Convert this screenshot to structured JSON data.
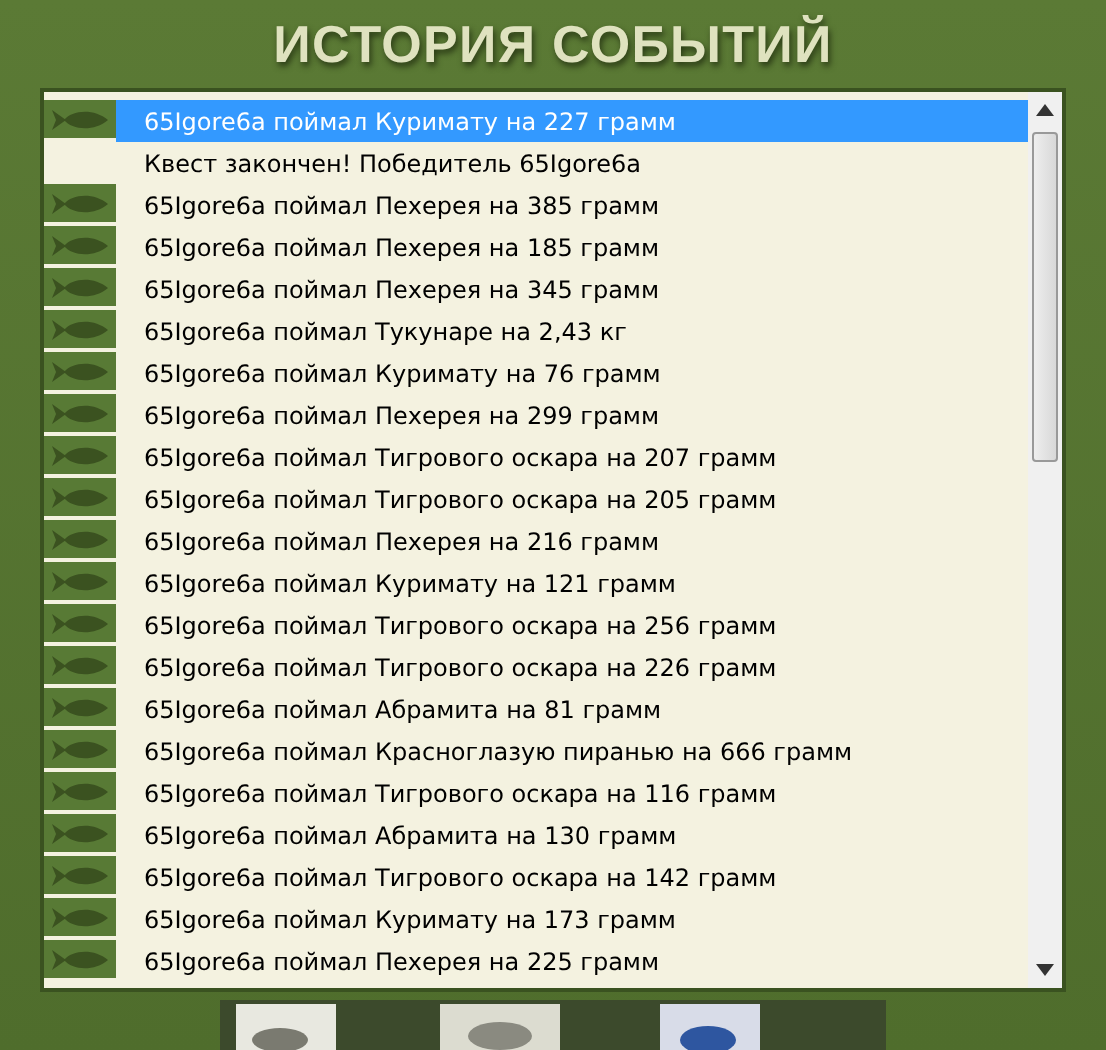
{
  "title": "ИСТОРИЯ СОБЫТИЙ",
  "events": [
    {
      "kind": "catch",
      "text": "65Igore6a поймал Куримату на 227 грамм",
      "selected": true
    },
    {
      "kind": "message",
      "text": "Квест закончен! Победитель 65Igore6a",
      "selected": false
    },
    {
      "kind": "catch",
      "text": "65Igore6a поймал Пехерея на 385 грамм",
      "selected": false
    },
    {
      "kind": "catch",
      "text": "65Igore6a поймал Пехерея на 185 грамм",
      "selected": false
    },
    {
      "kind": "catch",
      "text": "65Igore6a поймал Пехерея на 345 грамм",
      "selected": false
    },
    {
      "kind": "catch",
      "text": "65Igore6a поймал Тукунаре на 2,43 кг",
      "selected": false
    },
    {
      "kind": "catch",
      "text": "65Igore6a поймал Куримату на 76 грамм",
      "selected": false
    },
    {
      "kind": "catch",
      "text": "65Igore6a поймал Пехерея на 299 грамм",
      "selected": false
    },
    {
      "kind": "catch",
      "text": "65Igore6a поймал Тигрового оскара на 207 грамм",
      "selected": false
    },
    {
      "kind": "catch",
      "text": "65Igore6a поймал Тигрового оскара на 205 грамм",
      "selected": false
    },
    {
      "kind": "catch",
      "text": "65Igore6a поймал Пехерея на 216 грамм",
      "selected": false
    },
    {
      "kind": "catch",
      "text": "65Igore6a поймал Куримату на 121 грамм",
      "selected": false
    },
    {
      "kind": "catch",
      "text": "65Igore6a поймал Тигрового оскара на 256 грамм",
      "selected": false
    },
    {
      "kind": "catch",
      "text": "65Igore6a поймал Тигрового оскара на 226 грамм",
      "selected": false
    },
    {
      "kind": "catch",
      "text": "65Igore6a поймал Абрамита на 81 грамм",
      "selected": false
    },
    {
      "kind": "catch",
      "text": "65Igore6a поймал Красноглазую пиранью на 666 грамм",
      "selected": false
    },
    {
      "kind": "catch",
      "text": "65Igore6a поймал Тигрового оскара на 116 грамм",
      "selected": false
    },
    {
      "kind": "catch",
      "text": "65Igore6a поймал Абрамита на 130 грамм",
      "selected": false
    },
    {
      "kind": "catch",
      "text": "65Igore6a поймал Тигрового оскара на 142 грамм",
      "selected": false
    },
    {
      "kind": "catch",
      "text": "65Igore6a поймал Куримату на 173 грамм",
      "selected": false
    },
    {
      "kind": "catch",
      "text": "65Igore6a поймал Пехерея на 225 грамм",
      "selected": false
    }
  ]
}
